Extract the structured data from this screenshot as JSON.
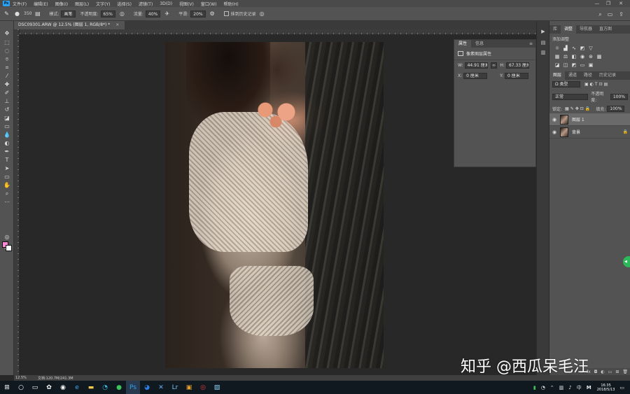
{
  "menubar": {
    "logo": "Ps",
    "items": [
      "文件(F)",
      "编辑(E)",
      "图像(I)",
      "图层(L)",
      "文字(Y)",
      "选择(S)",
      "滤镜(T)",
      "3D(D)",
      "视图(V)",
      "窗口(W)",
      "帮助(H)"
    ],
    "minimize": "—",
    "restore": "❐",
    "close": "✕"
  },
  "options": {
    "brush_size": "350",
    "mode_label": "模式:",
    "mode_value": "画笔",
    "opacity_label": "不透明度:",
    "opacity_value": "65%",
    "flow_label": "流量:",
    "flow_value": "40%",
    "smooth_label": "平滑:",
    "smooth_value": "20%",
    "erase_history_label": "抹到历史记录"
  },
  "document": {
    "tab_title": "DSC09301.ARW @ 12.5% (图层 1, RGB/8*) *",
    "close": "×"
  },
  "properties": {
    "tab_properties": "属性",
    "tab_info": "信息",
    "header": "像素图层属性",
    "w_label": "W:",
    "w_value": "44.91 厘米",
    "h_label": "H:",
    "h_value": "67.33 厘米",
    "x_label": "X:",
    "x_value": "0 厘米",
    "y_label": "Y:",
    "y_value": "0 厘米",
    "link": "∞"
  },
  "right_panels": {
    "top_tabs": [
      "库",
      "调整",
      "导航器",
      "直方图"
    ],
    "adjust_title": "添加调整",
    "layer_tabs": [
      "图层",
      "通道",
      "路径",
      "历史记录"
    ],
    "filter_kind": "Ω 类型",
    "blend_mode": "正常",
    "opacity_label": "不透明度:",
    "opacity_value": "100%",
    "lock_label": "锁定:",
    "fill_label": "填充:",
    "fill_value": "100%",
    "layers": [
      {
        "name": "图层 1",
        "selected": true
      },
      {
        "name": "背景",
        "selected": false,
        "locked": true
      }
    ]
  },
  "status": {
    "zoom": "12.5%",
    "doc_info": "文档:120.7M/241.3M"
  },
  "watermark": "知乎 @西瓜呆毛汪",
  "taskbar": {
    "time": "16:35",
    "date": "2018/5/13",
    "ime": "中",
    "tray_m": "M"
  }
}
